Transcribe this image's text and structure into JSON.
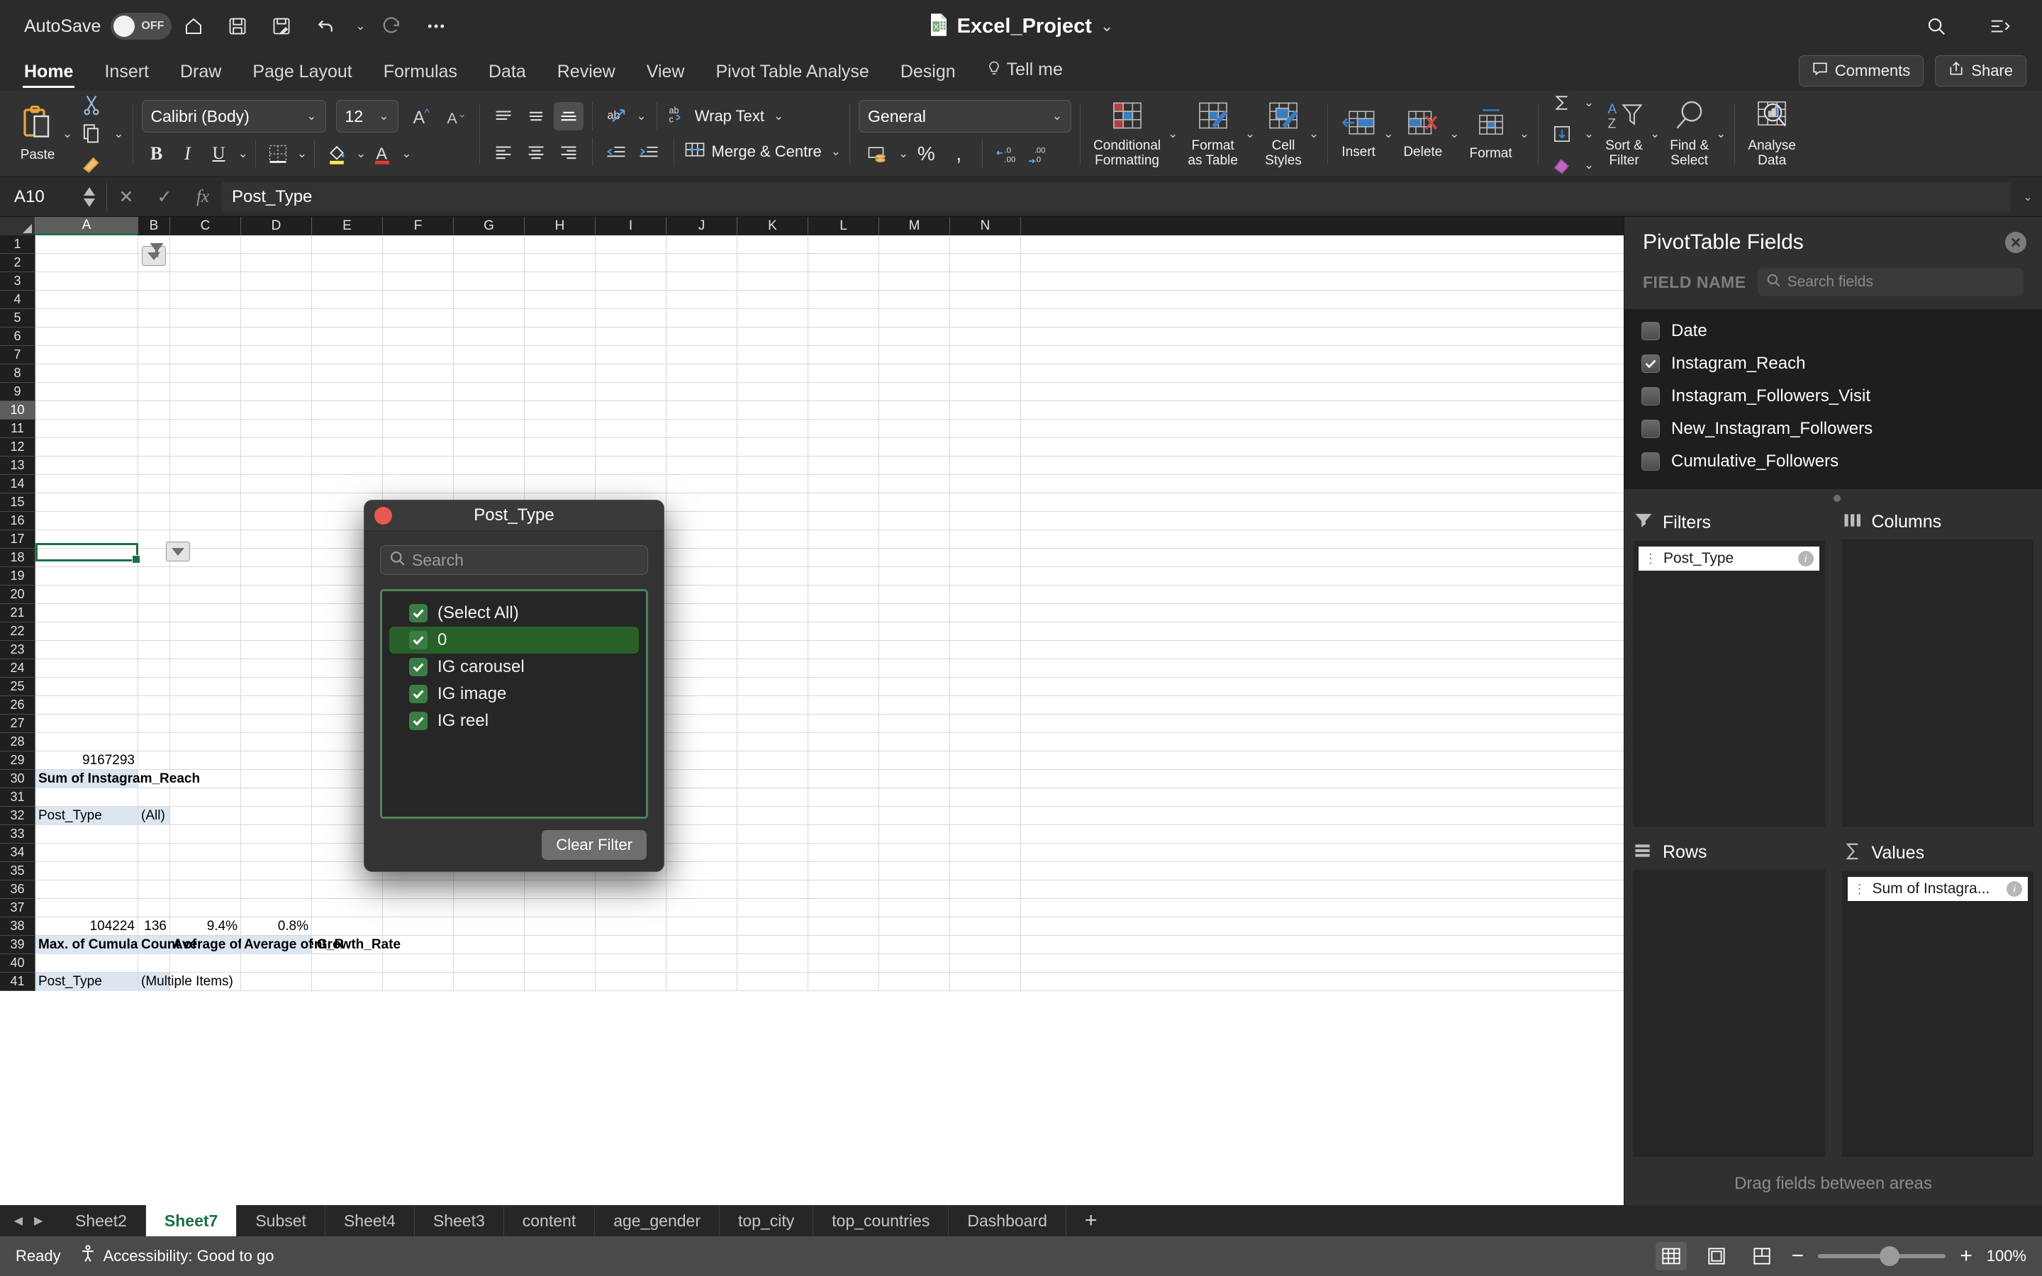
{
  "titlebar": {
    "autosave_label": "AutoSave",
    "autosave_state": "OFF",
    "doc_title": "Excel_Project",
    "icons": [
      "home-icon",
      "save-icon",
      "save-as-icon",
      "undo-icon",
      "redo-icon",
      "more-icon"
    ],
    "right_icons": [
      "search-icon",
      "ribbon-display-icon"
    ]
  },
  "ribbon_tabs": [
    {
      "label": "Home",
      "active": true
    },
    {
      "label": "Insert",
      "active": false
    },
    {
      "label": "Draw",
      "active": false
    },
    {
      "label": "Page Layout",
      "active": false
    },
    {
      "label": "Formulas",
      "active": false
    },
    {
      "label": "Data",
      "active": false
    },
    {
      "label": "Review",
      "active": false
    },
    {
      "label": "View",
      "active": false
    },
    {
      "label": "Pivot Table Analyse",
      "active": false
    },
    {
      "label": "Design",
      "active": false
    },
    {
      "label": "Tell me",
      "active": false
    }
  ],
  "ribbon_right": {
    "comments_label": "Comments",
    "share_label": "Share"
  },
  "ribbon": {
    "paste_label": "Paste",
    "font_name": "Calibri (Body)",
    "font_size": "12",
    "wrap_text_label": "Wrap Text",
    "merge_centre_label": "Merge & Centre",
    "number_format": "General",
    "conditional_formatting_label": "Conditional\nFormatting",
    "conditional_formatting_line1": "Conditional",
    "conditional_formatting_line2": "Formatting",
    "format_as_table_line1": "Format",
    "format_as_table_line2": "as Table",
    "cell_styles_line1": "Cell",
    "cell_styles_line2": "Styles",
    "insert_label": "Insert",
    "delete_label": "Delete",
    "format_label": "Format",
    "sort_filter_line1": "Sort &",
    "sort_filter_line2": "Filter",
    "find_select_line1": "Find &",
    "find_select_line2": "Select",
    "analyse_data_line1": "Analyse",
    "analyse_data_line2": "Data"
  },
  "formula_bar": {
    "name_box": "A10",
    "formula": "Post_Type",
    "cancel_icon": "cancel-icon",
    "confirm_icon": "confirm-icon",
    "fx_icon": "fx-icon"
  },
  "grid": {
    "columns": [
      "A",
      "B",
      "C",
      "D",
      "E",
      "F",
      "G",
      "H",
      "I",
      "J",
      "K",
      "L",
      "M",
      "N"
    ],
    "selected_column": "A",
    "selected_row": "10",
    "rows": [
      "1",
      "2",
      "3",
      "4",
      "5",
      "6",
      "7",
      "8",
      "9",
      "10",
      "11",
      "12",
      "13",
      "14",
      "15",
      "16",
      "17",
      "18",
      "19",
      "20",
      "21",
      "22",
      "23",
      "24",
      "25",
      "26",
      "27",
      "28",
      "29",
      "30",
      "31",
      "32",
      "33",
      "34",
      "35",
      "36",
      "37",
      "38",
      "39",
      "40",
      "41"
    ],
    "cells": [
      {
        "row": 1,
        "col": 0,
        "value": "Post_Type",
        "style": "hdrfill"
      },
      {
        "row": 1,
        "col": 1,
        "value": "(Multiple Items)",
        "style": "hdrfill ovf"
      },
      {
        "row": 3,
        "col": 0,
        "value": "Max. of Cumulative_Follow",
        "style": "hdrfill bold"
      },
      {
        "row": 3,
        "col": 1,
        "value": "Count of",
        "style": "hdrfill bold ovf"
      },
      {
        "row": 3,
        "col": 2,
        "value": "Average of Engagement_R",
        "style": "hdrfill bold"
      },
      {
        "row": 3,
        "col": 3,
        "value": "Average of Growth_Rate",
        "style": "hdrfill bold ovf"
      },
      {
        "row": 4,
        "col": 0,
        "value": "104224",
        "style": "num"
      },
      {
        "row": 4,
        "col": 1,
        "value": "136",
        "style": "num"
      },
      {
        "row": 4,
        "col": 2,
        "value": "9.4%",
        "style": "num"
      },
      {
        "row": 4,
        "col": 3,
        "value": "0.8%",
        "style": "num"
      },
      {
        "row": 10,
        "col": 0,
        "value": "Post_Type",
        "style": "hdrfill"
      },
      {
        "row": 10,
        "col": 1,
        "value": "(All)",
        "style": "hdrfill"
      },
      {
        "row": 12,
        "col": 0,
        "value": "Sum of Instagram_Reach",
        "style": "hdrfill bold ovf"
      },
      {
        "row": 13,
        "col": 0,
        "value": "9167293",
        "style": "num"
      }
    ]
  },
  "filter_dialog": {
    "title": "Post_Type",
    "search_placeholder": "Search",
    "items": [
      {
        "label": "(Select All)",
        "checked": true,
        "highlighted": false
      },
      {
        "label": "0",
        "checked": true,
        "highlighted": true
      },
      {
        "label": "IG carousel",
        "checked": true,
        "highlighted": false
      },
      {
        "label": "IG image",
        "checked": true,
        "highlighted": false
      },
      {
        "label": "IG reel",
        "checked": true,
        "highlighted": false
      }
    ],
    "clear_filter_label": "Clear Filter"
  },
  "pivot_panel": {
    "title": "PivotTable Fields",
    "field_name_label": "FIELD NAME",
    "search_placeholder": "Search fields",
    "fields": [
      {
        "label": "Date",
        "checked": false
      },
      {
        "label": "Instagram_Reach",
        "checked": true
      },
      {
        "label": "Instagram_Followers_Visit",
        "checked": false
      },
      {
        "label": "New_Instagram_Followers",
        "checked": false
      },
      {
        "label": "Cumulative_Followers",
        "checked": false
      }
    ],
    "areas": [
      {
        "name": "Filters",
        "icon": "filter-icon",
        "pills": [
          "Post_Type"
        ]
      },
      {
        "name": "Columns",
        "icon": "columns-icon",
        "pills": []
      },
      {
        "name": "Rows",
        "icon": "rows-icon",
        "pills": []
      },
      {
        "name": "Values",
        "icon": "sigma-icon",
        "pills": [
          "Sum of Instagra..."
        ]
      }
    ],
    "footer": "Drag fields between areas"
  },
  "sheet_tabs": [
    {
      "label": "Sheet2",
      "active": false
    },
    {
      "label": "Sheet7",
      "active": true
    },
    {
      "label": "Subset",
      "active": false
    },
    {
      "label": "Sheet4",
      "active": false
    },
    {
      "label": "Sheet3",
      "active": false
    },
    {
      "label": "content",
      "active": false
    },
    {
      "label": "age_gender",
      "active": false
    },
    {
      "label": "top_city",
      "active": false
    },
    {
      "label": "top_countries",
      "active": false
    },
    {
      "label": "Dashboard",
      "active": false
    }
  ],
  "add_sheet_label": "+",
  "status_bar": {
    "ready": "Ready",
    "accessibility": "Accessibility: Good to go",
    "zoom_level": "100%",
    "zoom_out": "−",
    "zoom_in": "+"
  },
  "colors": {
    "accent_green": "#1d6f42",
    "header_fill": "#dce6f1",
    "dialog_green": "#3a7d44"
  }
}
